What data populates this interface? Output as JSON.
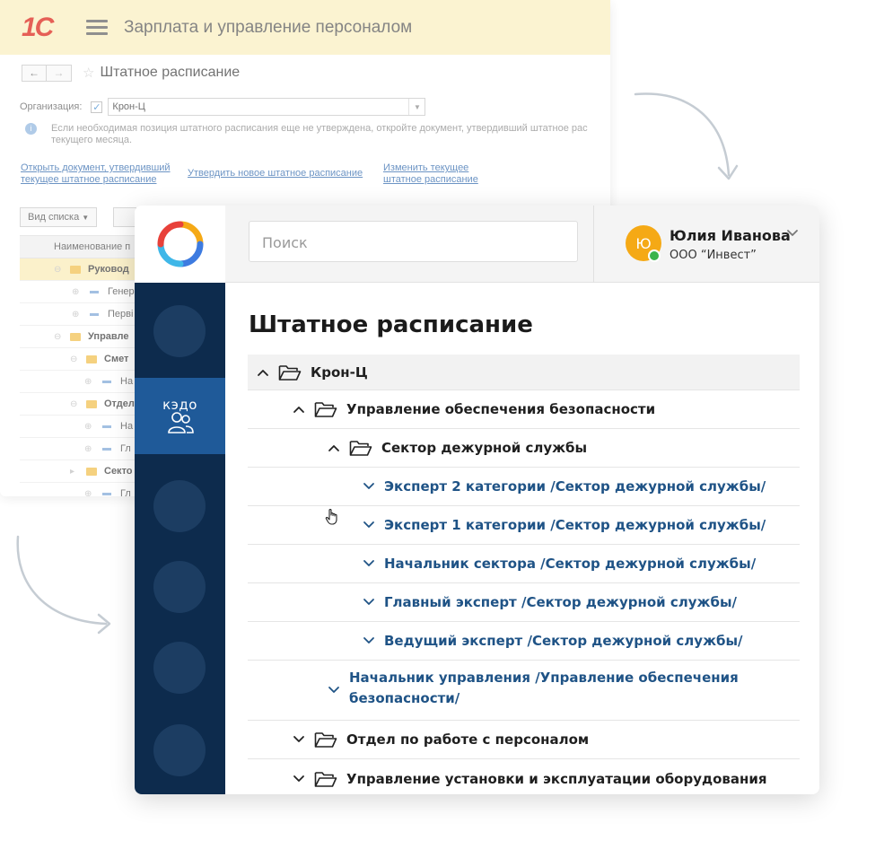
{
  "background_window": {
    "logo": "1С",
    "app_title": "Зарплата и управление персоналом",
    "doc_title": "Штатное расписание",
    "org_label": "Организация:",
    "org_value": "Крон-Ц",
    "info_text_1": "Если необходимая позиция штатного расписания еще не утверждена, откройте документ, утвердивший штатное рас",
    "info_text_2": "текущего месяца.",
    "links": {
      "open_doc_1": "Открыть документ, утвердивший",
      "open_doc_2": "текущее штатное расписание",
      "approve_new": "Утвердить новое штатное расписание",
      "change_1": "Изменить текущее",
      "change_2": "штатное расписание"
    },
    "list_view_button": "Вид списка",
    "table_header": "Наименование п",
    "rows": [
      {
        "kind": "group",
        "text": "Руковод",
        "selected": true
      },
      {
        "kind": "item",
        "text": "Генер"
      },
      {
        "kind": "item",
        "text": "Перві"
      },
      {
        "kind": "group",
        "text": "Управле"
      },
      {
        "kind": "subgroup",
        "text": "Смет"
      },
      {
        "kind": "subitem",
        "text": "На"
      },
      {
        "kind": "subgroup",
        "text": "Отдел"
      },
      {
        "kind": "subitem",
        "text": "На"
      },
      {
        "kind": "subitem",
        "text": "Гл"
      },
      {
        "kind": "subgroup",
        "text": "Секто"
      },
      {
        "kind": "subitem",
        "text": "Гл"
      }
    ]
  },
  "app": {
    "search_placeholder": "Поиск",
    "user": {
      "initials": "Ю",
      "name": "Юлия Иванова",
      "org": "ООО “Инвест”",
      "status_color": "#3cb44b"
    },
    "sidebar": {
      "active_label": "кэдо",
      "active_icon": "users-icon",
      "colors": {
        "bg": "#0d2b4d",
        "active": "#1f5a99",
        "circle": "#1c3d62"
      }
    },
    "page_title": "Штатное расписание",
    "tree": [
      {
        "level": 0,
        "type": "folder",
        "expanded": true,
        "text": "Крон-Ц"
      },
      {
        "level": 1,
        "type": "folder",
        "expanded": true,
        "text": "Управление обеспечения безопасности"
      },
      {
        "level": 2,
        "type": "folder",
        "expanded": true,
        "text": "Сектор дежурной службы"
      },
      {
        "level": 3,
        "type": "position",
        "text": "Эксперт 2 категории /Сектор дежурной службы/"
      },
      {
        "level": 3,
        "type": "position",
        "text": "Эксперт 1 категории /Сектор дежурной службы/"
      },
      {
        "level": 3,
        "type": "position",
        "text": "Начальник сектора /Сектор дежурной службы/"
      },
      {
        "level": 3,
        "type": "position",
        "text": "Главный эксперт /Сектор дежурной службы/"
      },
      {
        "level": 3,
        "type": "position",
        "text": "Ведущий эксперт /Сектор дежурной службы/"
      },
      {
        "level": 2,
        "type": "position",
        "text_line1": "Начальник управления /Управление обеспечения",
        "text_line2": "безопасности/"
      },
      {
        "level": 1,
        "type": "folder",
        "expanded": false,
        "text": "Отдел по работе с персоналом"
      },
      {
        "level": 1,
        "type": "folder",
        "expanded": false,
        "text": "Управление установки и эксплуатации оборудования"
      }
    ],
    "colors": {
      "position_text": "#1f5386",
      "brand_orange": "#f5a915"
    }
  }
}
